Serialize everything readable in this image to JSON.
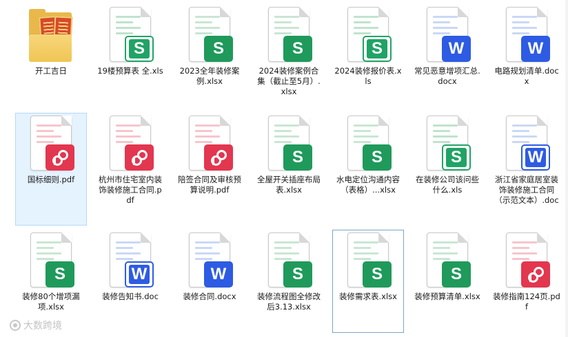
{
  "window": {
    "view": "large-icons"
  },
  "watermark": {
    "text": "大数跨境"
  },
  "type_styles": {
    "xls": {
      "letter": "S",
      "color": "#21a366",
      "outline": true,
      "lines": "#bfe3cd"
    },
    "xlsx": {
      "letter": "S",
      "color": "#1f9a5b",
      "outline": false,
      "lines": "#c9e6d3"
    },
    "docx": {
      "letter": "W",
      "color": "#2d5be3",
      "outline": false,
      "lines": "#cad8f5"
    },
    "doc": {
      "letter": "W",
      "color": "#2d5be3",
      "outline": true,
      "lines": "#cad8f5"
    },
    "pdf": {
      "letter": "",
      "color": "#e3364f",
      "outline": false,
      "lines": "#f6c5cd"
    }
  },
  "files": [
    {
      "name": "开工吉日",
      "type": "folder",
      "icon": "folder-icon"
    },
    {
      "name": "19楼预算表 全.xls",
      "type": "xls",
      "icon": "spreadsheet-icon"
    },
    {
      "name": "2023全年装修案例.xlsx",
      "type": "xlsx",
      "icon": "spreadsheet-icon"
    },
    {
      "name": "2024装修案例合集（截止至5月）.xlsx",
      "type": "xlsx",
      "icon": "spreadsheet-icon"
    },
    {
      "name": "2024装修报价表.xls",
      "type": "xls",
      "icon": "spreadsheet-icon"
    },
    {
      "name": "常见恶意增项汇总.docx",
      "type": "docx",
      "icon": "word-document-icon"
    },
    {
      "name": "电路规划清单.docx",
      "type": "docx",
      "icon": "word-document-icon"
    },
    {
      "name": "国标细则.pdf",
      "type": "pdf",
      "icon": "pdf-document-icon",
      "selected": true
    },
    {
      "name": "杭州市住宅室内装饰装修施工合同.pdf",
      "type": "pdf",
      "icon": "pdf-document-icon"
    },
    {
      "name": "陪签合同及审核预算说明.pdf",
      "type": "pdf",
      "icon": "pdf-document-icon"
    },
    {
      "name": "全屋开关插座布局表.xlsx",
      "type": "xlsx",
      "icon": "spreadsheet-icon"
    },
    {
      "name": "水电定位沟通内容（表格）...xlsx",
      "type": "xlsx",
      "icon": "spreadsheet-icon"
    },
    {
      "name": "在装修公司该问些什么.xls",
      "type": "xls",
      "icon": "spreadsheet-icon"
    },
    {
      "name": "浙江省家庭居室装饰装修施工合同（示范文本）.doc",
      "type": "doc",
      "icon": "word-document-icon"
    },
    {
      "name": "装修80个增项漏项.xlsx",
      "type": "xlsx",
      "icon": "spreadsheet-icon"
    },
    {
      "name": "装修告知书.doc",
      "type": "doc",
      "icon": "word-document-icon"
    },
    {
      "name": "装修合同.docx",
      "type": "docx",
      "icon": "word-document-icon"
    },
    {
      "name": "装修流程图全修改后3.13.xlsx",
      "type": "xlsx",
      "icon": "spreadsheet-icon"
    },
    {
      "name": "装修需求表.xlsx",
      "type": "xlsx",
      "icon": "spreadsheet-icon",
      "focused": true
    },
    {
      "name": "装修预算清单.xlsx",
      "type": "xlsx",
      "icon": "spreadsheet-icon"
    },
    {
      "name": "装修指南124页.pdf",
      "type": "pdf",
      "icon": "pdf-document-icon"
    }
  ]
}
